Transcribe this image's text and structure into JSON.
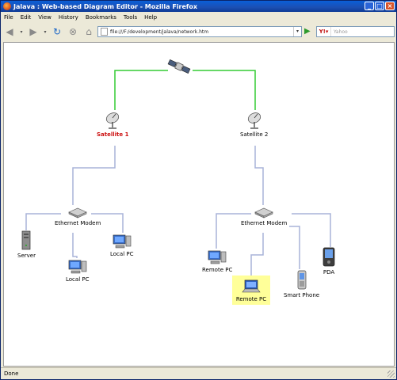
{
  "window": {
    "title": "Jalava : Web-based Diagram Editor - Mozilla Firefox"
  },
  "menu": [
    "File",
    "Edit",
    "View",
    "History",
    "Bookmarks",
    "Tools",
    "Help"
  ],
  "navbar": {
    "url": "file:///F:/development/jalava/network.htm",
    "search_engine_icon": "yahoo-icon",
    "search_placeholder": "Yahoo"
  },
  "diagram": {
    "nodes": {
      "satellite": {
        "label": ""
      },
      "dish1": {
        "label": "Satellite 1",
        "color": "#cc1010"
      },
      "dish2": {
        "label": "Satellite 2"
      },
      "modem1": {
        "label": "Ethernet Modem"
      },
      "modem2": {
        "label": "Ethernet Modem"
      },
      "server": {
        "label": "Server"
      },
      "localpc1": {
        "label": "Local PC"
      },
      "localpc2": {
        "label": "Local PC"
      },
      "remotepc1": {
        "label": "Remote PC"
      },
      "remotepc2": {
        "label": "Remote PC",
        "selected": true,
        "highlight": "#ffff99"
      },
      "smartphone": {
        "label": "Smart Phone"
      },
      "pda": {
        "label": "PDA"
      }
    },
    "link_colors": {
      "satellite": "#33cc33",
      "network": "#a8b4d8"
    }
  },
  "status": {
    "text": "Done"
  }
}
